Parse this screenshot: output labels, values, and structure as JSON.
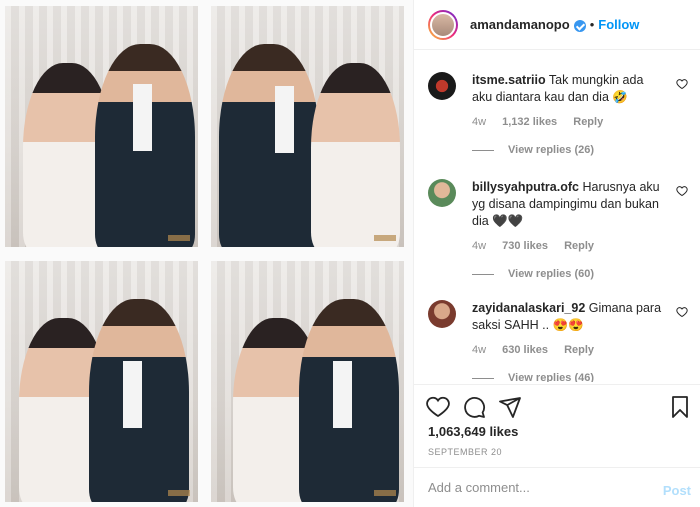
{
  "post": {
    "username": "amandamanopo",
    "follow_label": "Follow",
    "separator": "•"
  },
  "comments": [
    {
      "username": "itsme.satriio",
      "text": "Tak mungkin ada aku diantara kau dan dia 🤣",
      "age": "4w",
      "likes": "1,132 likes",
      "reply_label": "Reply",
      "view_replies": "View replies (26)"
    },
    {
      "username": "billysyahputra.ofc",
      "text": "Harusnya aku yg disana dampingimu dan bukan dia 🖤🖤",
      "age": "4w",
      "likes": "730 likes",
      "reply_label": "Reply",
      "view_replies": "View replies (60)"
    },
    {
      "username": "zayidanalaskari_92",
      "text": "Gimana para saksi SAHH .. 😍😍",
      "age": "4w",
      "likes": "630 likes",
      "reply_label": "Reply",
      "view_replies": "View replies (46)"
    }
  ],
  "stats": {
    "likes": "1,063,649 likes",
    "date": "SEPTEMBER 20"
  },
  "composer": {
    "placeholder": "Add a comment...",
    "post_label": "Post"
  },
  "icons": {
    "like": "heart-icon",
    "comment": "comment-icon",
    "share": "share-icon",
    "save": "bookmark-icon"
  },
  "colors": {
    "accent": "#0095f6",
    "verified": "#3897f0",
    "muted": "#8e8e8e"
  }
}
